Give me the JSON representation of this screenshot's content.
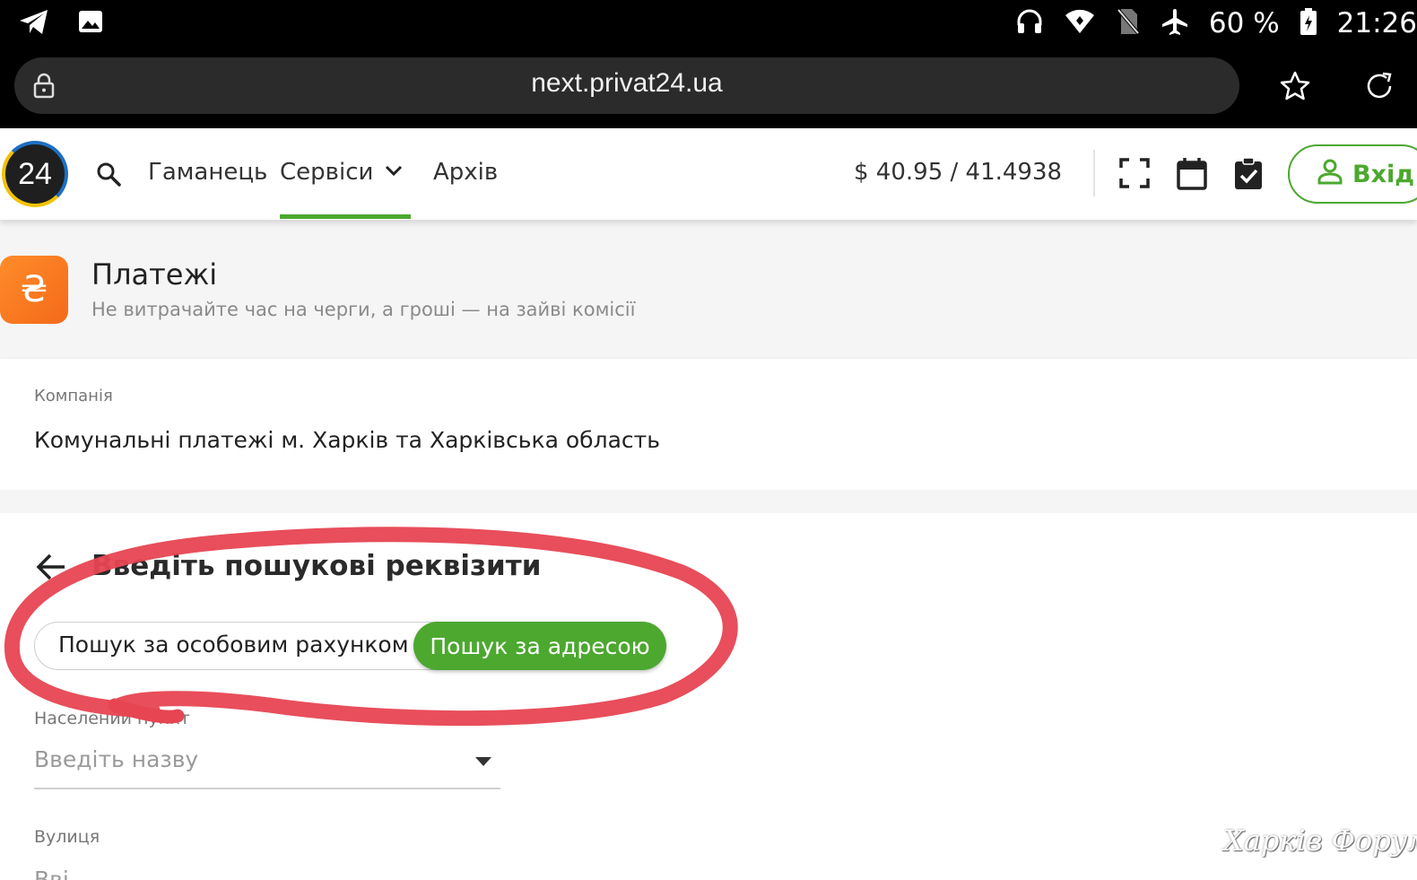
{
  "status_bar": {
    "left_icons": [
      "telegram-icon",
      "image-icon"
    ],
    "right_icons": [
      "headphones-icon",
      "wifi-icon",
      "no-sim-icon",
      "airplane-icon",
      "battery-icon"
    ],
    "battery_text": "60 %",
    "time": "21:26"
  },
  "browser": {
    "url": "next.privat24.ua"
  },
  "header": {
    "logo_text": "24",
    "nav": {
      "wallet": "Гаманець",
      "services": "Сервіси",
      "archive": "Архів"
    },
    "rate": "$  40.95 / 41.4938",
    "login_label": "Вхід",
    "colors": {
      "accent": "#4ca82f"
    }
  },
  "page": {
    "icon_symbol": "₴",
    "title": "Платежі",
    "subtitle": "Не витрачайте час на черги, а гроші — на зайві комісії"
  },
  "company": {
    "label": "Компанія",
    "value": "Комунальні платежі м. Харків та Харківська область"
  },
  "search": {
    "title": "Введіть пошукові реквізити",
    "toggle_account": "Пошук за особовим рахунком",
    "toggle_address": "Пошук за адресою",
    "selected": "Пошук за адресою",
    "settlement_label": "Населений пункт",
    "settlement_placeholder": "Введіть назву",
    "street_label": "Вулиця",
    "street_placeholder_cut": "Вві"
  },
  "watermark": "Харків Форум"
}
